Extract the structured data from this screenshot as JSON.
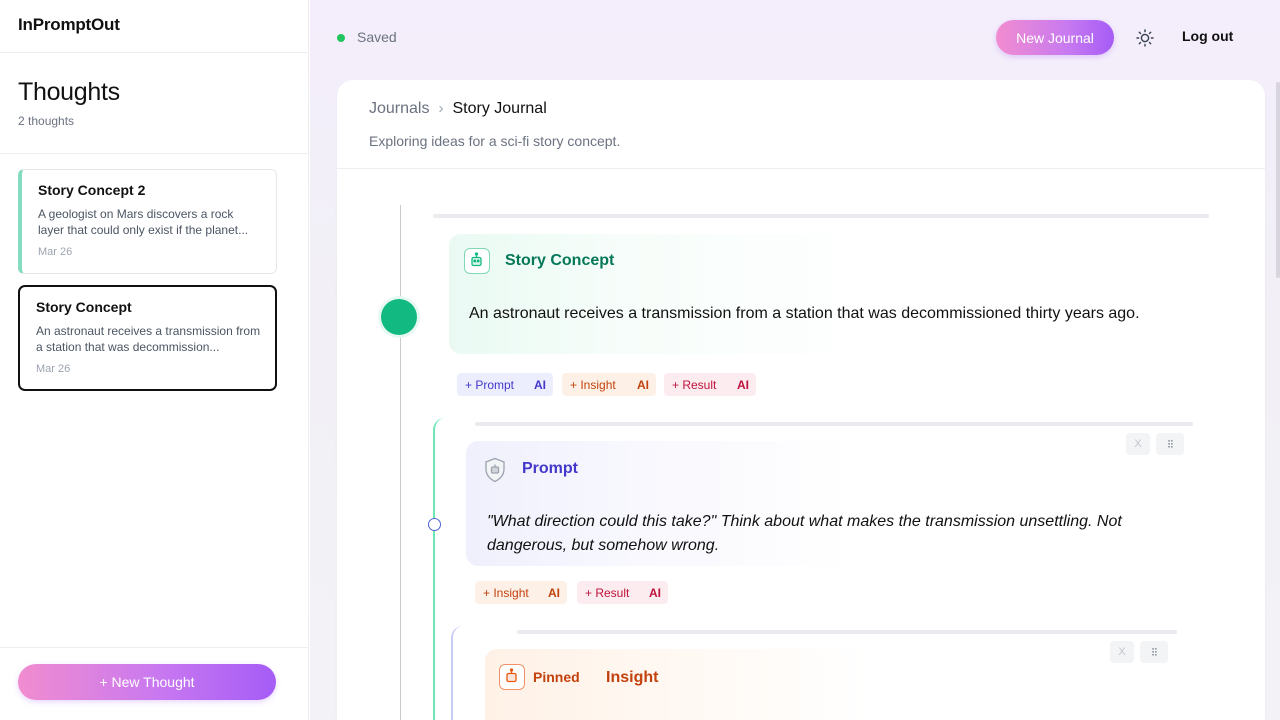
{
  "sidebar": {
    "brand": "InPromptOut",
    "title": "Thoughts",
    "count": "2 thoughts",
    "cards": [
      {
        "title": "Story Concept 2",
        "text": "A geologist on Mars discovers a rock layer that could only exist if the planet...",
        "date": "Mar 26"
      },
      {
        "title": "Story Concept",
        "text": "An astronaut receives a transmission from a station that was decommission...",
        "date": "Mar 26"
      }
    ],
    "new_thought_label": "+ New Thought"
  },
  "header": {
    "status": "Saved",
    "new_journal_label": "New Journal",
    "logout_label": "Log out"
  },
  "journal": {
    "breadcrumb_root": "Journals",
    "breadcrumb_sep": "›",
    "breadcrumb_current": "Story Journal",
    "description": "Exploring ideas for a sci-fi story concept."
  },
  "nodes": {
    "concept": {
      "title": "Story Concept",
      "text": "An astronaut receives a transmission from a station that was decommissioned thirty years ago.",
      "chips": [
        {
          "label": "+ Prompt",
          "ai": "AI"
        },
        {
          "label": "+ Insight",
          "ai": "AI"
        },
        {
          "label": "+ Result",
          "ai": "AI"
        }
      ]
    },
    "prompt": {
      "title": "Prompt",
      "text": "\"What direction could this take?\" Think about what makes the transmission unsettling. Not dangerous, but somehow wrong.",
      "close_label": "X",
      "grip_label": "⁝⁝",
      "chips": [
        {
          "label": "+ Insight",
          "ai": "AI"
        },
        {
          "label": "+ Result",
          "ai": "AI"
        }
      ]
    },
    "insight": {
      "pinned_label": "Pinned",
      "title": "Insight",
      "close_label": "X",
      "grip_label": "⁝⁝"
    }
  },
  "colors": {
    "accent_green": "#12b981",
    "prompt_purple": "#4338ca",
    "insight_orange": "#c2410c",
    "result_red": "#be123c"
  }
}
